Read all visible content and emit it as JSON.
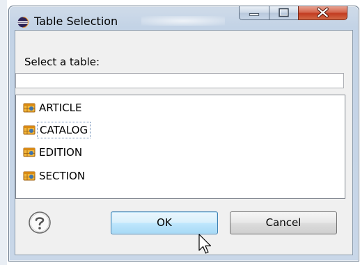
{
  "window": {
    "title": "Table Selection",
    "icon": "eclipse-icon"
  },
  "dialog": {
    "prompt": "Select a table:",
    "filter": {
      "value": "",
      "placeholder": ""
    },
    "tables": [
      {
        "label": "ARTICLE",
        "icon": "table-icon",
        "selected": false
      },
      {
        "label": "CATALOG",
        "icon": "table-icon",
        "selected": true
      },
      {
        "label": "EDITION",
        "icon": "table-icon",
        "selected": false
      },
      {
        "label": "SECTION",
        "icon": "table-icon",
        "selected": false
      }
    ],
    "help_icon": "help-icon",
    "ok_label": "OK",
    "cancel_label": "Cancel"
  },
  "colors": {
    "titlebar": "#c3d3e6",
    "close_button": "#c23b20",
    "default_button_border": "#3c7fb1"
  }
}
